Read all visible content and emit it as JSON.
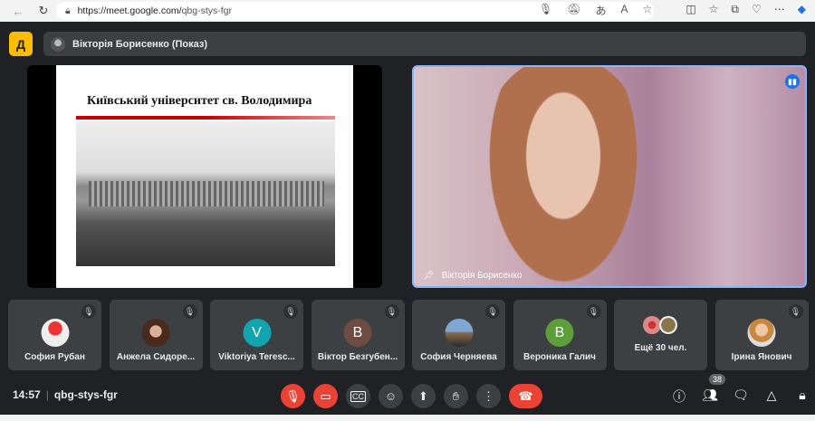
{
  "browser": {
    "url_host": "https://meet.google.com/",
    "url_path": "qbg-stys-fgr"
  },
  "presentation": {
    "presenter_label": "Вікторія Борисенко (Показ)",
    "slide_title": "Київський університет св. Володимира"
  },
  "speaker": {
    "name": "Вікторія Борисенко"
  },
  "participants": [
    {
      "name": "София Рубан",
      "avatar_color": "#c9c9c9",
      "initial": ""
    },
    {
      "name": "Анжела Сидоре...",
      "avatar_color": "#5a3a2a",
      "initial": ""
    },
    {
      "name": "Viktoriya Teresc...",
      "avatar_color": "#12a4af",
      "initial": "V"
    },
    {
      "name": "Віктор Безгубен...",
      "avatar_color": "#6d4c41",
      "initial": "В"
    },
    {
      "name": "София Черняева",
      "avatar_color": "#6b87a8",
      "initial": ""
    },
    {
      "name": "Вероника Галич",
      "avatar_color": "#5e9e3a",
      "initial": "В"
    },
    {
      "name": "Ірина Янович",
      "avatar_color": "#c9a88a",
      "initial": ""
    }
  ],
  "more_participants": "Ещё 30 чел.",
  "footer": {
    "time": "14:57",
    "meeting_code": "qbg-stys-fgr",
    "people_count": "38"
  }
}
